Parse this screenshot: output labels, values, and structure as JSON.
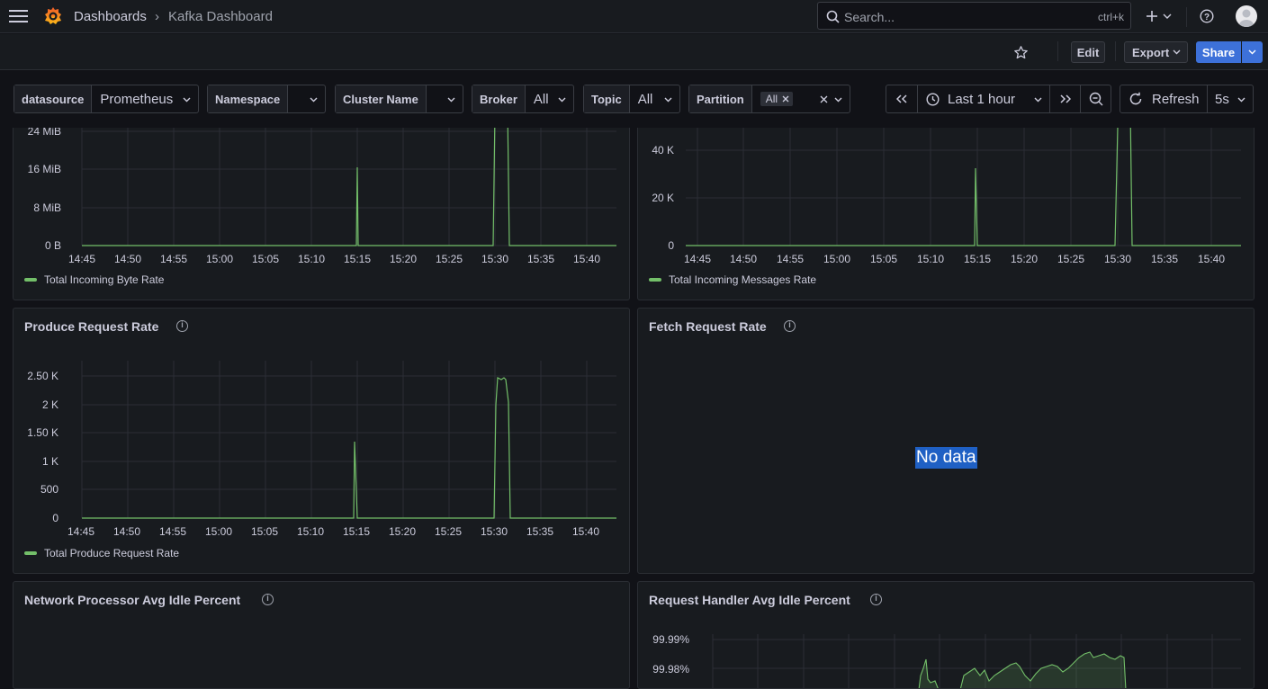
{
  "header": {
    "breadcrumb_root": "Dashboards",
    "breadcrumb_sep": "›",
    "breadcrumb_current": "Kafka Dashboard",
    "search_placeholder": "Search...",
    "search_shortcut": "ctrl+k"
  },
  "toolbar": {
    "edit_label": "Edit",
    "export_label": "Export",
    "share_label": "Share"
  },
  "variables": [
    {
      "label": "datasource",
      "value": "Prometheus"
    },
    {
      "label": "Namespace",
      "value": ""
    },
    {
      "label": "Cluster Name",
      "value": ""
    },
    {
      "label": "Broker",
      "value": "All"
    },
    {
      "label": "Topic",
      "value": "All"
    },
    {
      "label": "Partition",
      "value": "All"
    }
  ],
  "time": {
    "range_label": "Last 1 hour",
    "refresh_label": "Refresh",
    "interval": "5s"
  },
  "colors": {
    "series": "#73bf69",
    "accent": "#3d71d9",
    "background": "#111217",
    "panel": "#181b1f"
  },
  "x_ticks": [
    "14:45",
    "14:50",
    "14:55",
    "15:00",
    "15:05",
    "15:10",
    "15:15",
    "15:20",
    "15:25",
    "15:30",
    "15:35",
    "15:40"
  ],
  "panels": {
    "byte_rate": {
      "title": "",
      "legend": "Total Incoming Byte Rate",
      "y_ticks": [
        "24 MiB",
        "16 MiB",
        "8 MiB",
        "0 B"
      ]
    },
    "messages_rate": {
      "title": "",
      "legend": "Total Incoming Messages Rate",
      "y_ticks": [
        "40 K",
        "20 K",
        "0"
      ]
    },
    "produce": {
      "title": "Produce Request Rate",
      "legend": "Total Produce Request Rate",
      "y_ticks": [
        "2.50 K",
        "2 K",
        "1.50 K",
        "1 K",
        "500",
        "0"
      ]
    },
    "fetch": {
      "title": "Fetch Request Rate",
      "no_data": "No data"
    },
    "network": {
      "title": "Network Processor Avg Idle Percent"
    },
    "handler": {
      "title": "Request Handler Avg Idle Percent",
      "y_ticks": [
        "99.99%",
        "99.98%"
      ]
    }
  },
  "chart_data": [
    {
      "type": "line",
      "series": [
        {
          "name": "Total Incoming Byte Rate",
          "values": [
            0,
            0,
            0,
            0,
            0,
            0,
            0,
            0,
            16,
            0,
            0,
            0,
            0,
            0,
            0,
            0,
            0,
            0,
            0,
            0,
            26,
            26,
            0,
            0,
            0,
            0,
            0,
            0,
            0
          ]
        }
      ],
      "x": [
        "14:43",
        "14:45",
        "14:50",
        "14:55",
        "15:00",
        "15:05",
        "15:10",
        "15:14:30",
        "15:14:45",
        "15:15",
        "15:20",
        "15:25",
        "15:29",
        "15:29:30",
        "15:29:45",
        "15:30",
        "15:30:15",
        "15:30:30",
        "15:30:45",
        "15:30:50",
        "15:30:55",
        "15:31:50",
        "15:32",
        "15:35",
        "15:40",
        "15:42",
        "15:43",
        "15:43",
        "15:43"
      ],
      "ylabel": "",
      "ylim": [
        0,
        26
      ],
      "unit": "MiB"
    },
    {
      "type": "line",
      "series": [
        {
          "name": "Total Incoming Messages Rate",
          "values": [
            0,
            0,
            32,
            0,
            0,
            0,
            60,
            60,
            0,
            0
          ]
        }
      ],
      "x": [
        "14:43",
        "15:14:30",
        "15:14:45",
        "15:15",
        "15:25",
        "15:29",
        "15:30",
        "15:31",
        "15:32",
        "15:43"
      ],
      "ylim": [
        0,
        50
      ],
      "unit": "K"
    },
    {
      "type": "line",
      "series": [
        {
          "name": "Total Produce Request Rate",
          "values": [
            0,
            0,
            1340,
            0,
            0,
            0,
            2000,
            2480,
            2440,
            2480,
            2000,
            0,
            0
          ]
        }
      ],
      "x": [
        "14:43",
        "15:14:30",
        "15:14:45",
        "15:15",
        "15:25",
        "15:29",
        "15:30",
        "15:30:30",
        "15:31",
        "15:31:30",
        "15:31:45",
        "15:32",
        "15:43"
      ],
      "ylim": [
        0,
        2500
      ]
    }
  ]
}
